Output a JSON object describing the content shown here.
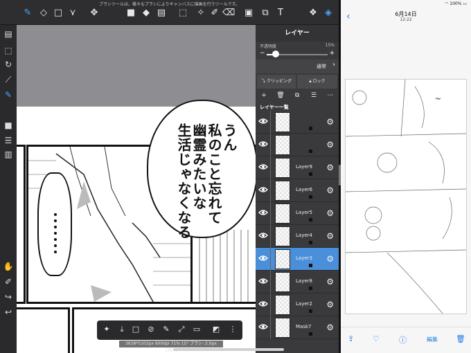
{
  "top_hint": "ブラシツールは、様々なブラシによりキャンバスに描画を行うツールです。",
  "toolbar_icons": [
    "brush-icon",
    "eraser-icon",
    "rect-icon",
    "shape-icon",
    "move-icon",
    "fill-color-icon",
    "bucket-icon",
    "gradient-icon",
    "select-rect-icon",
    "magic-wand-icon",
    "select-pen-icon",
    "select-eraser-icon",
    "window-icon",
    "transform-icon",
    "text-icon",
    "material-icon",
    "layers-icon"
  ],
  "left_icons": [
    "pages-icon",
    "select-icon",
    "rotate-icon",
    "ruler-icon",
    "eyedropper-blue-icon",
    "color-icon",
    "brush-list-icon",
    "palette-icon",
    "hand-icon",
    "eyedropper-icon",
    "redo-icon",
    "undo-icon"
  ],
  "speech": {
    "lines": [
      "うん",
      "私のこと忘れて",
      "幽霊みたいな",
      "生活じゃなくなる"
    ]
  },
  "bottom_status": "3638*5102px 600dpi 71% 15° ブラシ: 2.0px 100%",
  "layer_panel": {
    "title": "レイヤー",
    "opacity_label": "不透明度",
    "opacity_value": "15%",
    "opacity_fraction": 0.15,
    "blend_mode": "通常",
    "clipping_label": "クリッピング",
    "lock_label": "ロック",
    "list_title": "レイヤー一覧",
    "layers": [
      {
        "name": "",
        "selected": false
      },
      {
        "name": "",
        "selected": false
      },
      {
        "name": "Layer9",
        "selected": false
      },
      {
        "name": "Layer6",
        "selected": false
      },
      {
        "name": "Layer5",
        "selected": false
      },
      {
        "name": "Layer4",
        "selected": false
      },
      {
        "name": "Layer3",
        "selected": true
      },
      {
        "name": "Layer8",
        "selected": false
      },
      {
        "name": "Layer2",
        "selected": false
      },
      {
        "name": "Mask7",
        "selected": false
      }
    ]
  },
  "photos": {
    "status": "100%",
    "date": "6月14日",
    "time": "12:22",
    "edit_label": "編集"
  },
  "colors": {
    "accent": "#4aa3ff",
    "selected_layer": "#4a8fd9",
    "ios_blue": "#1f7aea"
  }
}
